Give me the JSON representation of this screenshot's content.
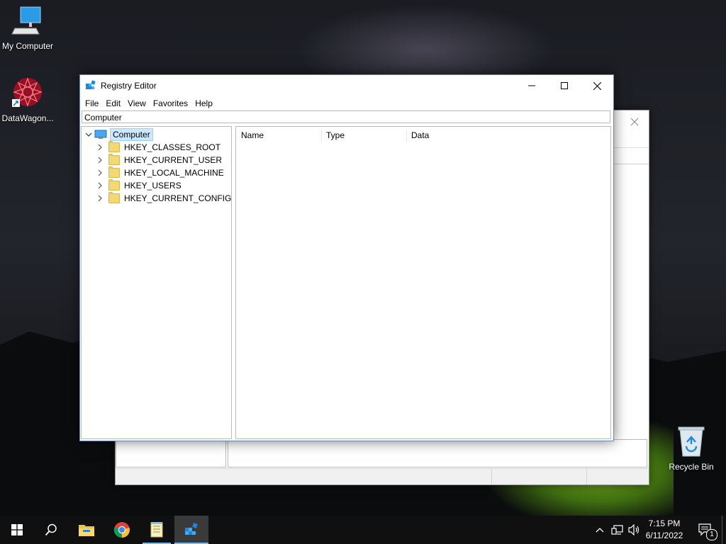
{
  "desktop": {
    "icons": [
      {
        "label": "My Computer",
        "icon": "my-computer-icon"
      },
      {
        "label": "DataWagon...",
        "icon": "datawagon-icon"
      },
      {
        "label": "Recycle Bin",
        "icon": "recycle-bin-icon"
      }
    ]
  },
  "window": {
    "title": "Registry Editor",
    "menu": [
      "File",
      "Edit",
      "View",
      "Favorites",
      "Help"
    ],
    "address": "Computer",
    "tree": {
      "root": "Computer",
      "children": [
        "HKEY_CLASSES_ROOT",
        "HKEY_CURRENT_USER",
        "HKEY_LOCAL_MACHINE",
        "HKEY_USERS",
        "HKEY_CURRENT_CONFIG"
      ]
    },
    "columns": [
      "Name",
      "Type",
      "Data"
    ]
  },
  "taskbar": {
    "pinned": [
      "start-icon",
      "search-icon",
      "file-explorer-icon",
      "chrome-icon",
      "notepad-icon",
      "registry-editor-icon"
    ],
    "time": "7:15 PM",
    "date": "6/11/2022",
    "notification_count": "1"
  },
  "colors": {
    "accent": "#0078d7",
    "selection": "#cce8ff",
    "taskbar": "#101010"
  }
}
